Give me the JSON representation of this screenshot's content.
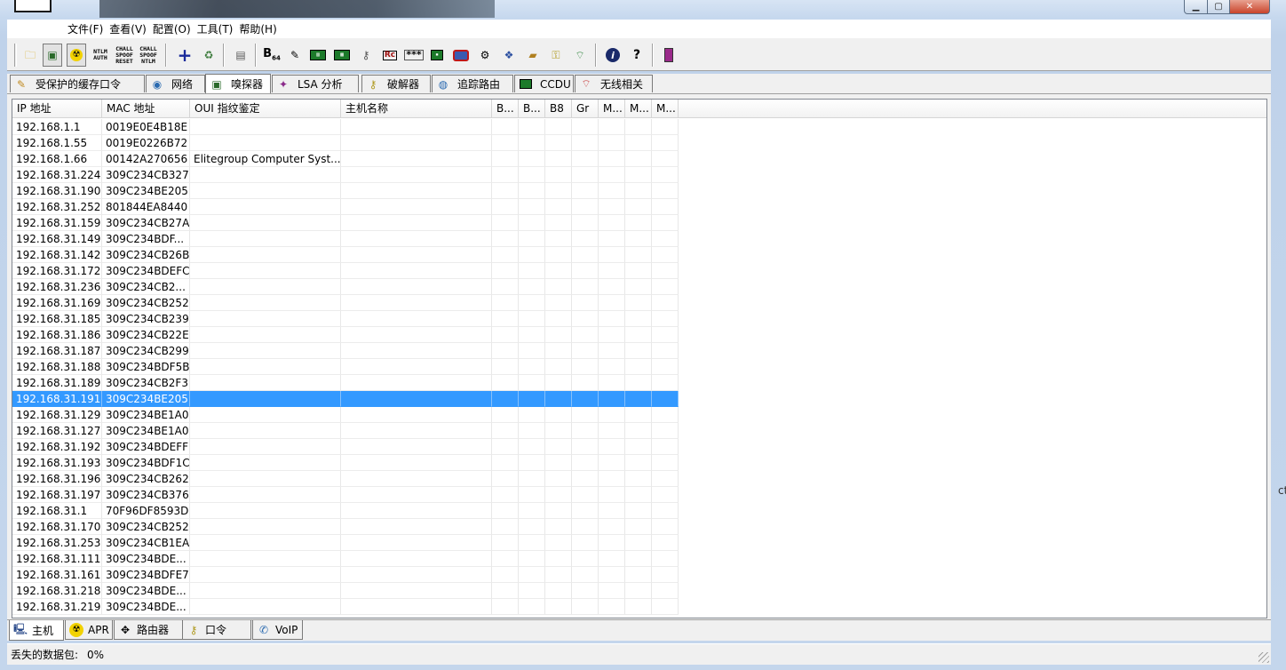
{
  "menubar": {
    "items": [
      "文件(F)",
      "查看(V)",
      "配置(O)",
      "工具(T)",
      "帮助(H)"
    ]
  },
  "toolbar": {
    "ntlm_auth": [
      "NTLM",
      "AUTH"
    ],
    "chall_spoof_reset": [
      "CHALL",
      "SPOOF",
      "RESET"
    ],
    "chall_spoof_ntlm": [
      "CHALL",
      "SPOOF",
      "NTLM"
    ],
    "b64": "B",
    "b64_sub": "64",
    "stars": "***",
    "info": "i",
    "help": "?"
  },
  "top_tabs": [
    {
      "label": "受保护的缓存口令",
      "icon": "cache-password-icon"
    },
    {
      "label": "网络",
      "icon": "network-icon"
    },
    {
      "label": "嗅探器",
      "icon": "sniffer-icon"
    },
    {
      "label": "LSA 分析",
      "icon": "lsa-icon"
    },
    {
      "label": "破解器",
      "icon": "cracker-icon"
    },
    {
      "label": "追踪路由",
      "icon": "traceroute-icon"
    },
    {
      "label": "CCDU",
      "icon": "ccdu-icon"
    },
    {
      "label": "无线相关",
      "icon": "wireless-icon"
    }
  ],
  "table": {
    "columns": [
      "IP 地址",
      "MAC 地址",
      "OUI 指纹鉴定",
      "主机名称",
      "B...",
      "B...",
      "B8",
      "Gr",
      "M...",
      "M...",
      "M..."
    ],
    "rows": [
      [
        "192.168.1.1",
        "0019E0E4B18E",
        ""
      ],
      [
        "192.168.1.55",
        "0019E0226B72",
        ""
      ],
      [
        "192.168.1.66",
        "00142A270656",
        "Elitegroup Computer Syst..."
      ],
      [
        "192.168.31.224",
        "309C234CB327",
        ""
      ],
      [
        "192.168.31.190",
        "309C234BE205",
        ""
      ],
      [
        "192.168.31.252",
        "801844EA8440",
        ""
      ],
      [
        "192.168.31.159",
        "309C234CB27A",
        ""
      ],
      [
        "192.168.31.149",
        "309C234BDF...",
        ""
      ],
      [
        "192.168.31.142",
        "309C234CB26B",
        ""
      ],
      [
        "192.168.31.172",
        "309C234BDEFC",
        ""
      ],
      [
        "192.168.31.236",
        "309C234CB2...",
        ""
      ],
      [
        "192.168.31.169",
        "309C234CB252",
        ""
      ],
      [
        "192.168.31.185",
        "309C234CB239",
        ""
      ],
      [
        "192.168.31.186",
        "309C234CB22E",
        ""
      ],
      [
        "192.168.31.187",
        "309C234CB299",
        ""
      ],
      [
        "192.168.31.188",
        "309C234BDF5B",
        ""
      ],
      [
        "192.168.31.189",
        "309C234CB2F3",
        ""
      ],
      [
        "192.168.31.191",
        "309C234BE205",
        ""
      ],
      [
        "192.168.31.129",
        "309C234BE1A0",
        ""
      ],
      [
        "192.168.31.127",
        "309C234BE1A0",
        ""
      ],
      [
        "192.168.31.192",
        "309C234BDEFF",
        ""
      ],
      [
        "192.168.31.193",
        "309C234BDF1C",
        ""
      ],
      [
        "192.168.31.196",
        "309C234CB262",
        ""
      ],
      [
        "192.168.31.197",
        "309C234CB376",
        ""
      ],
      [
        "192.168.31.1",
        "70F96DF8593D",
        ""
      ],
      [
        "192.168.31.170",
        "309C234CB252",
        ""
      ],
      [
        "192.168.31.253",
        "309C234CB1EA",
        ""
      ],
      [
        "192.168.31.111",
        "309C234BDE...",
        ""
      ],
      [
        "192.168.31.161",
        "309C234BDFE7",
        ""
      ],
      [
        "192.168.31.218",
        "309C234BDE...",
        ""
      ],
      [
        "192.168.31.219",
        "309C234BDE...",
        ""
      ]
    ],
    "selected_row": 17
  },
  "bottom_tabs": [
    {
      "label": "主机",
      "icon": "host-icon"
    },
    {
      "label": "APR",
      "icon": "apr-icon"
    },
    {
      "label": "路由器",
      "icon": "router-icon"
    },
    {
      "label": "口令",
      "icon": "password-icon"
    },
    {
      "label": "VoIP",
      "icon": "voip-icon"
    }
  ],
  "statusbar": {
    "label": "丢失的数据包:",
    "value": "0%"
  },
  "edge_text": "ct",
  "colors": {
    "selection": "#3399ff",
    "window_frame": "#c6d8ee",
    "close_button": "#c9432a"
  }
}
